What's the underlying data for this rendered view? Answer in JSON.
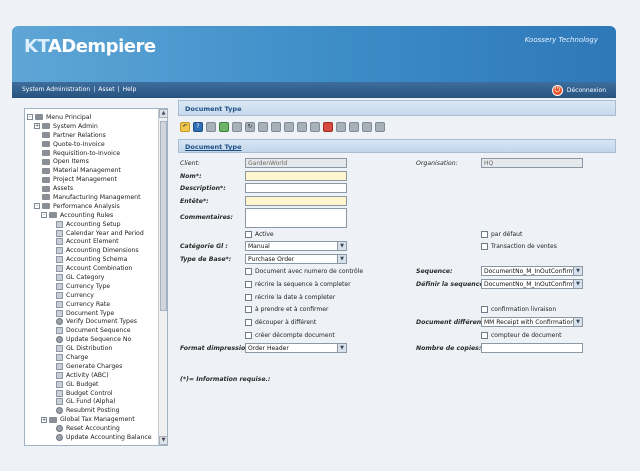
{
  "header": {
    "logo_kt": "KT",
    "logo_ad": "ADempiere",
    "brand_right": "Koossery Technology"
  },
  "topnav": {
    "link_system_admin": "System Administration",
    "link_asset": "Asset",
    "link_help": "Help",
    "separator": "|",
    "logout": "Déconnexion"
  },
  "tree": {
    "items": [
      {
        "label": "Menu Principal",
        "level": 0,
        "type": "folder",
        "expander": "-"
      },
      {
        "label": "System Admin",
        "level": 1,
        "type": "folder",
        "expander": "+"
      },
      {
        "label": "Partner Relations",
        "level": 1,
        "type": "folder",
        "expander": ""
      },
      {
        "label": "Quote-to-Invoice",
        "level": 1,
        "type": "folder",
        "expander": ""
      },
      {
        "label": "Requisition-to-Invoice",
        "level": 1,
        "type": "folder",
        "expander": ""
      },
      {
        "label": "Open Items",
        "level": 1,
        "type": "folder",
        "expander": ""
      },
      {
        "label": "Material Management",
        "level": 1,
        "type": "folder",
        "expander": ""
      },
      {
        "label": "Project Management",
        "level": 1,
        "type": "folder",
        "expander": ""
      },
      {
        "label": "Assets",
        "level": 1,
        "type": "folder",
        "expander": ""
      },
      {
        "label": "Manufacturing Management",
        "level": 1,
        "type": "folder",
        "expander": ""
      },
      {
        "label": "Performance Analysis",
        "level": 1,
        "type": "folder",
        "expander": "-"
      },
      {
        "label": "Accounting Rules",
        "level": 2,
        "type": "folder",
        "expander": "-"
      },
      {
        "label": "Accounting Setup",
        "level": 3,
        "type": "leaf",
        "expander": ""
      },
      {
        "label": "Calendar Year and Period",
        "level": 3,
        "type": "leaf",
        "expander": ""
      },
      {
        "label": "Account Element",
        "level": 3,
        "type": "leaf",
        "expander": ""
      },
      {
        "label": "Accounting Dimensions",
        "level": 3,
        "type": "leaf",
        "expander": ""
      },
      {
        "label": "Accounting Schema",
        "level": 3,
        "type": "leaf",
        "expander": ""
      },
      {
        "label": "Account Combination",
        "level": 3,
        "type": "leaf",
        "expander": ""
      },
      {
        "label": "GL Category",
        "level": 3,
        "type": "leaf",
        "expander": ""
      },
      {
        "label": "Currency Type",
        "level": 3,
        "type": "leaf",
        "expander": ""
      },
      {
        "label": "Currency",
        "level": 3,
        "type": "leaf",
        "expander": ""
      },
      {
        "label": "Currency Rate",
        "level": 3,
        "type": "leaf",
        "expander": ""
      },
      {
        "label": "Document Type",
        "level": 3,
        "type": "leaf",
        "expander": ""
      },
      {
        "label": "Verify Document Types",
        "level": 3,
        "type": "gear",
        "expander": ""
      },
      {
        "label": "Document Sequence",
        "level": 3,
        "type": "leaf",
        "expander": ""
      },
      {
        "label": "Update Sequence No",
        "level": 3,
        "type": "gear",
        "expander": ""
      },
      {
        "label": "GL Distribution",
        "level": 3,
        "type": "leaf",
        "expander": ""
      },
      {
        "label": "Charge",
        "level": 3,
        "type": "leaf",
        "expander": ""
      },
      {
        "label": "Generate Charges",
        "level": 3,
        "type": "leaf",
        "expander": ""
      },
      {
        "label": "Activity (ABC)",
        "level": 3,
        "type": "leaf",
        "expander": ""
      },
      {
        "label": "GL Budget",
        "level": 3,
        "type": "leaf",
        "expander": ""
      },
      {
        "label": "Budget Control",
        "level": 3,
        "type": "leaf",
        "expander": ""
      },
      {
        "label": "GL Fund (Alpha)",
        "level": 3,
        "type": "leaf",
        "expander": ""
      },
      {
        "label": "Resubmit Posting",
        "level": 3,
        "type": "gear",
        "expander": ""
      },
      {
        "label": "Global Tax Management",
        "level": 2,
        "type": "folder",
        "expander": "+"
      },
      {
        "label": "Reset Accounting",
        "level": 3,
        "type": "gear",
        "expander": ""
      },
      {
        "label": "Update Accounting Balance",
        "level": 3,
        "type": "gear",
        "expander": ""
      }
    ]
  },
  "main": {
    "title": "Document Type",
    "tab": "Document Type"
  },
  "form": {
    "client_label": "Client:",
    "client_value": "GardenWorld",
    "organisation_label": "Organisation:",
    "organisation_value": "HQ",
    "nom_label": "Nom*:",
    "description_label": "Description*:",
    "entete_label": "Entête*:",
    "commentaires_label": "Commentaires:",
    "active_label": "Active",
    "par_defaut_label": "par défaut",
    "categorie_gl_label": "Catégorie Gl :",
    "categorie_gl_value": "Manual",
    "transaction_ventes_label": "Transaction de ventes",
    "type_base_label": "Type de Base*:",
    "type_base_value": "Purchase Order",
    "doc_num_controle_label": "Document avec numero de contrôle",
    "sequence_label": "Sequence:",
    "sequence_value": "DocumentNo_M_InOutConfirm",
    "recrire_sequence_label": "récrire la sequence à completer",
    "definir_sequence_label": "Définir la sequence:",
    "definir_sequence_value": "DocumentNo_M_InOutConfirm",
    "recrire_date_label": "récrire la date à completer",
    "a_prendre_label": "à prendre et à confirmer",
    "confirmation_livraison_label": "confirmation livraison",
    "decouper_label": "découper à différent",
    "document_different_label": "Document différent:",
    "document_different_value": "MM Receipt with Confirmation",
    "creer_decompte_label": "créer décompte document",
    "compteur_document_label": "compteur de document",
    "format_impression_label": "Format dimpression:",
    "format_impression_value": "Order Header",
    "nombre_copies_label": "Nombre de copies:",
    "info_note": "(*)= Information requise.:"
  },
  "colors": {
    "header_blue": "#3c8cc8",
    "nav_dark": "#27527e",
    "title_text": "#1f4f86",
    "mandatory_field": "#fff6cf"
  },
  "icons": {
    "toolbar": [
      "undo-icon",
      "help-icon",
      "new-icon",
      "copy-icon",
      "save-icon",
      "refresh-icon",
      "find-icon",
      "attachment-icon",
      "zoom-icon",
      "history-icon",
      "zoom-across-icon",
      "home-icon",
      "print-preview-icon",
      "print-icon",
      "export-icon",
      "report-icon"
    ],
    "logout": "power-icon"
  }
}
